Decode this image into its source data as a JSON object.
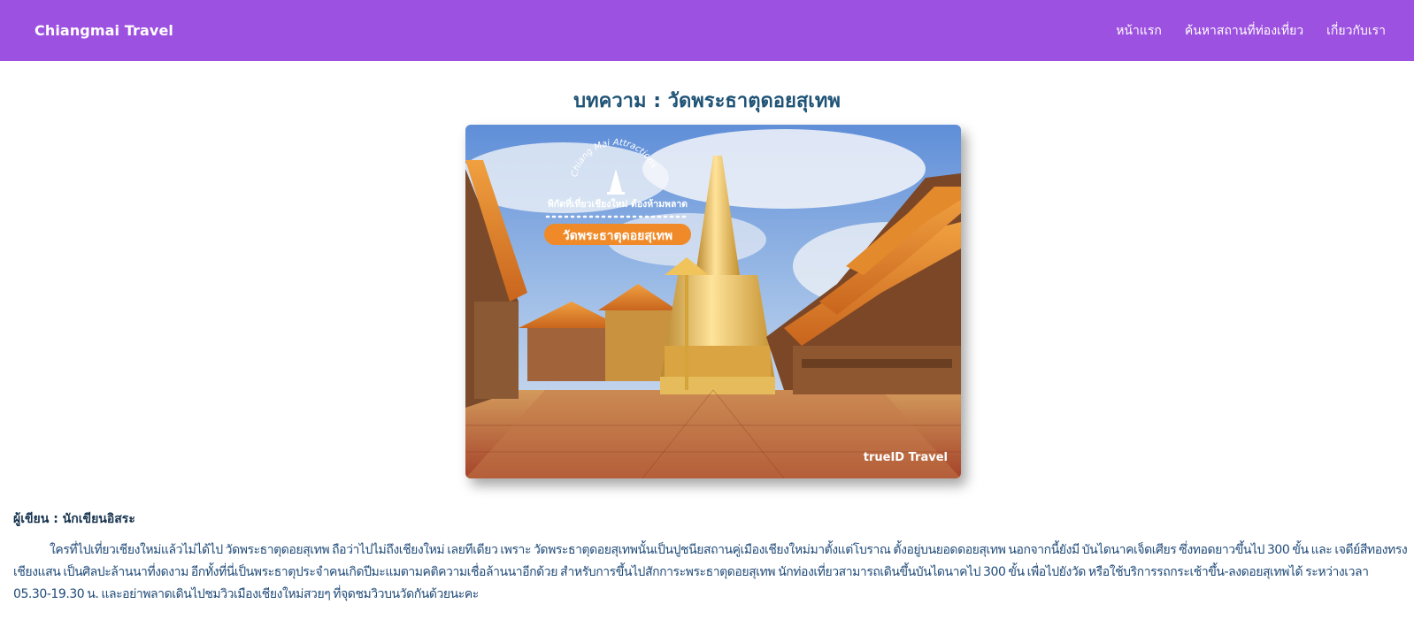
{
  "header": {
    "brand": "Chiangmai Travel",
    "nav": [
      {
        "label": "หน้าแรก"
      },
      {
        "label": "ค้นหาสถานที่ท่องเที่ยว"
      },
      {
        "label": "เกี่ยวกับเรา"
      }
    ],
    "background_color": "#9d51e0"
  },
  "article": {
    "title": "บทความ : วัดพระธาตุดอยสุเทพ",
    "image": {
      "logo_arc_text": "Chiang Mai Attractions",
      "tagline": "พิกัดที่เที่ยวเชียงใหม่ ต้องห้ามพลาด",
      "badge_text": "วัดพระธาตุดอยสุเทพ",
      "watermark": "trueID Travel"
    },
    "author": "ผู้เขียน : นักเขียนอิสระ",
    "body": "ใครที่ไปเที่ยวเชียงใหม่แล้วไม่ได้ไป วัดพระธาตุดอยสุเทพ ถือว่าไปไม่ถึงเชียงใหม่ เลยทีเดียว เพราะ วัดพระธาตุดอยสุเทพนั้นเป็นปูชนียสถานคู่เมืองเชียงใหม่มาตั้งแต่โบราณ ตั้งอยู่บนยอดดอยสุเทพ นอกจากนี้ยังมี บันไดนาคเจ็ดเศียร ซึ่งทอดยาวขึ้นไป 300 ขั้น และ เจดีย์สีทองทรงเชียงแสน เป็นศิลปะล้านนาที่งดงาม อีกทั้งที่นี่เป็นพระธาตุประจำคนเกิดปีมะแมตามคติความเชื่อล้านนาอีกด้วย สำหรับการขึ้นไปสักการะพระธาตุดอยสุเทพ นักท่องเที่ยวสามารถเดินขึ้นบันไดนาคไป 300 ขั้น เพื่อไปยังวัด หรือใช้บริการรถกระเช้าขึ้น-ลงดอยสุเทพได้ ระหว่างเวลา 05.30-19.30 น. และอย่าพลาดเดินไปชมวิวเมืองเชียงใหม่สวยๆ ที่จุดชมวิวบนวัดกันด้วยนะคะ"
  }
}
